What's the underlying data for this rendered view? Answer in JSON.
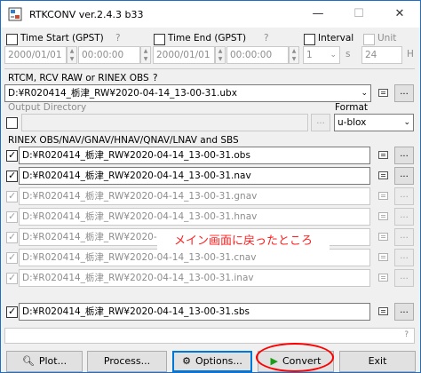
{
  "window": {
    "title": "RTKCONV ver.2.4.3 b33",
    "controls": {
      "minimize": "—",
      "maximize": "☐",
      "close": "✕"
    }
  },
  "time_row": {
    "time_start_label": "Time Start (GPST)",
    "time_start_help": "?",
    "start_date": "2000/01/01",
    "start_time": "00:00:00",
    "time_end_label": "Time End (GPST)",
    "time_end_help": "?",
    "end_date": "2000/01/01",
    "end_time": "00:00:00",
    "interval_label": "Interval",
    "interval_value": "1",
    "interval_unit": "s",
    "unit_label": "Unit",
    "unit_value": "24",
    "unit_suffix": "H"
  },
  "input": {
    "label": "RTCM, RCV RAW or RINEX OBS",
    "help": "?",
    "path": "D:¥R020414_栃津_RW¥2020-04-14_13-00-31.ubx",
    "browse": "..."
  },
  "output_dir": {
    "label": "Output Directory",
    "value": "",
    "browse": "...",
    "format_label": "Format",
    "format_value": "u-blox"
  },
  "rinex": {
    "label": "RINEX OBS/NAV/GNAV/HNAV/QNAV/LNAV and SBS",
    "files": [
      {
        "path": "D:¥R020414_栃津_RW¥2020-04-14_13-00-31.obs",
        "enabled": true
      },
      {
        "path": "D:¥R020414_栃津_RW¥2020-04-14_13-00-31.nav",
        "enabled": true
      },
      {
        "path": "D:¥R020414_栃津_RW¥2020-04-14_13-00-31.gnav",
        "enabled": false
      },
      {
        "path": "D:¥R020414_栃津_RW¥2020-04-14_13-00-31.hnav",
        "enabled": false
      },
      {
        "path": "D:¥R020414_栃津_RW¥2020-04-14_13-00-31.qnav",
        "enabled": false
      },
      {
        "path": "D:¥R020414_栃津_RW¥2020-04-14_13-00-31.cnav",
        "enabled": false
      },
      {
        "path": "D:¥R020414_栃津_RW¥2020-04-14_13-00-31.inav",
        "enabled": false
      },
      {
        "path": "D:¥R020414_栃津_RW¥2020-04-14_13-00-31.sbs",
        "enabled": true
      }
    ],
    "browse": "..."
  },
  "status": {
    "help": "?"
  },
  "buttons": {
    "plot": "Plot...",
    "process": "Process...",
    "options": "Options...",
    "convert": "Convert",
    "exit": "Exit"
  },
  "annotation": {
    "text": "メイン画面に戻ったところ"
  },
  "colors": {
    "annotation_red": "#ff1e1e",
    "focus_blue": "#0078d7",
    "convert_icon": "#1a9c1a"
  }
}
